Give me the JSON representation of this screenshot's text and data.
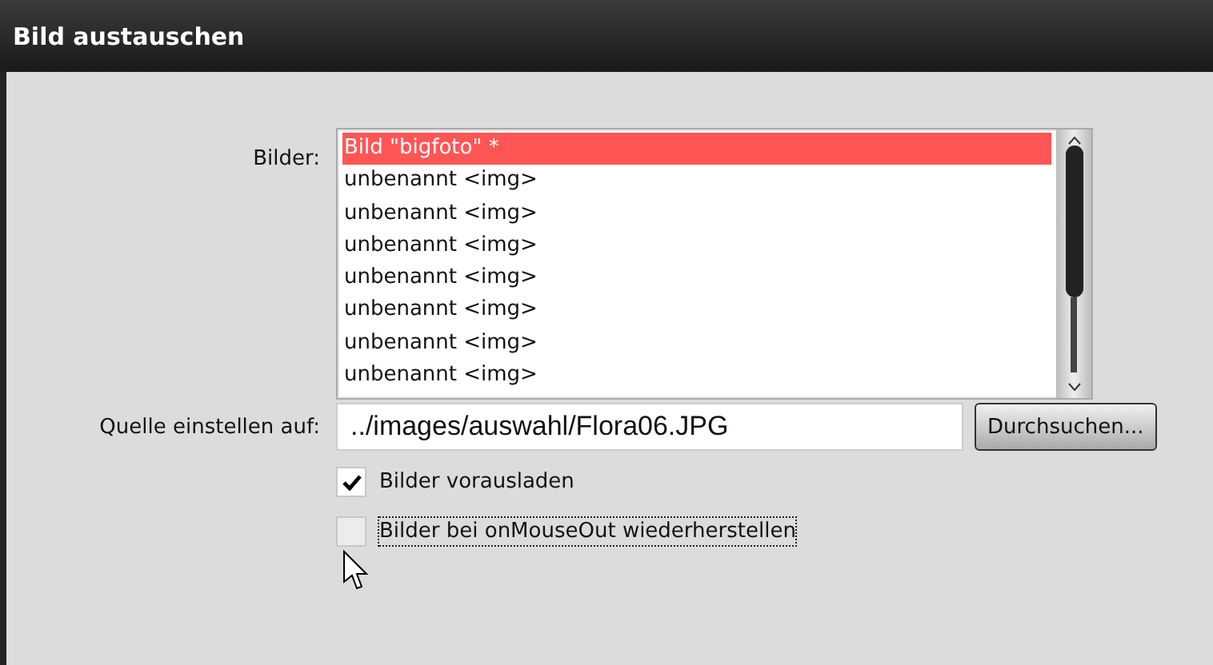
{
  "window": {
    "title": "Bild austauschen"
  },
  "images": {
    "label": "Bilder:",
    "items": [
      {
        "text": "Bild \"bigfoto\" *",
        "selected": true
      },
      {
        "text": "unbenannt <img>",
        "selected": false
      },
      {
        "text": "unbenannt <img>",
        "selected": false
      },
      {
        "text": "unbenannt <img>",
        "selected": false
      },
      {
        "text": "unbenannt <img>",
        "selected": false
      },
      {
        "text": "unbenannt <img>",
        "selected": false
      },
      {
        "text": "unbenannt <img>",
        "selected": false
      },
      {
        "text": "unbenannt <img>",
        "selected": false
      }
    ]
  },
  "source": {
    "label": "Quelle einstellen auf:",
    "value": "../images/auswahl/Flora06.JPG",
    "button": "Durchsuchen..."
  },
  "options": [
    {
      "label": "Bilder vorausladen",
      "checked": true,
      "focused": false
    },
    {
      "label": "Bilder bei onMouseOut wiederherstellen",
      "checked": false,
      "focused": true
    }
  ]
}
